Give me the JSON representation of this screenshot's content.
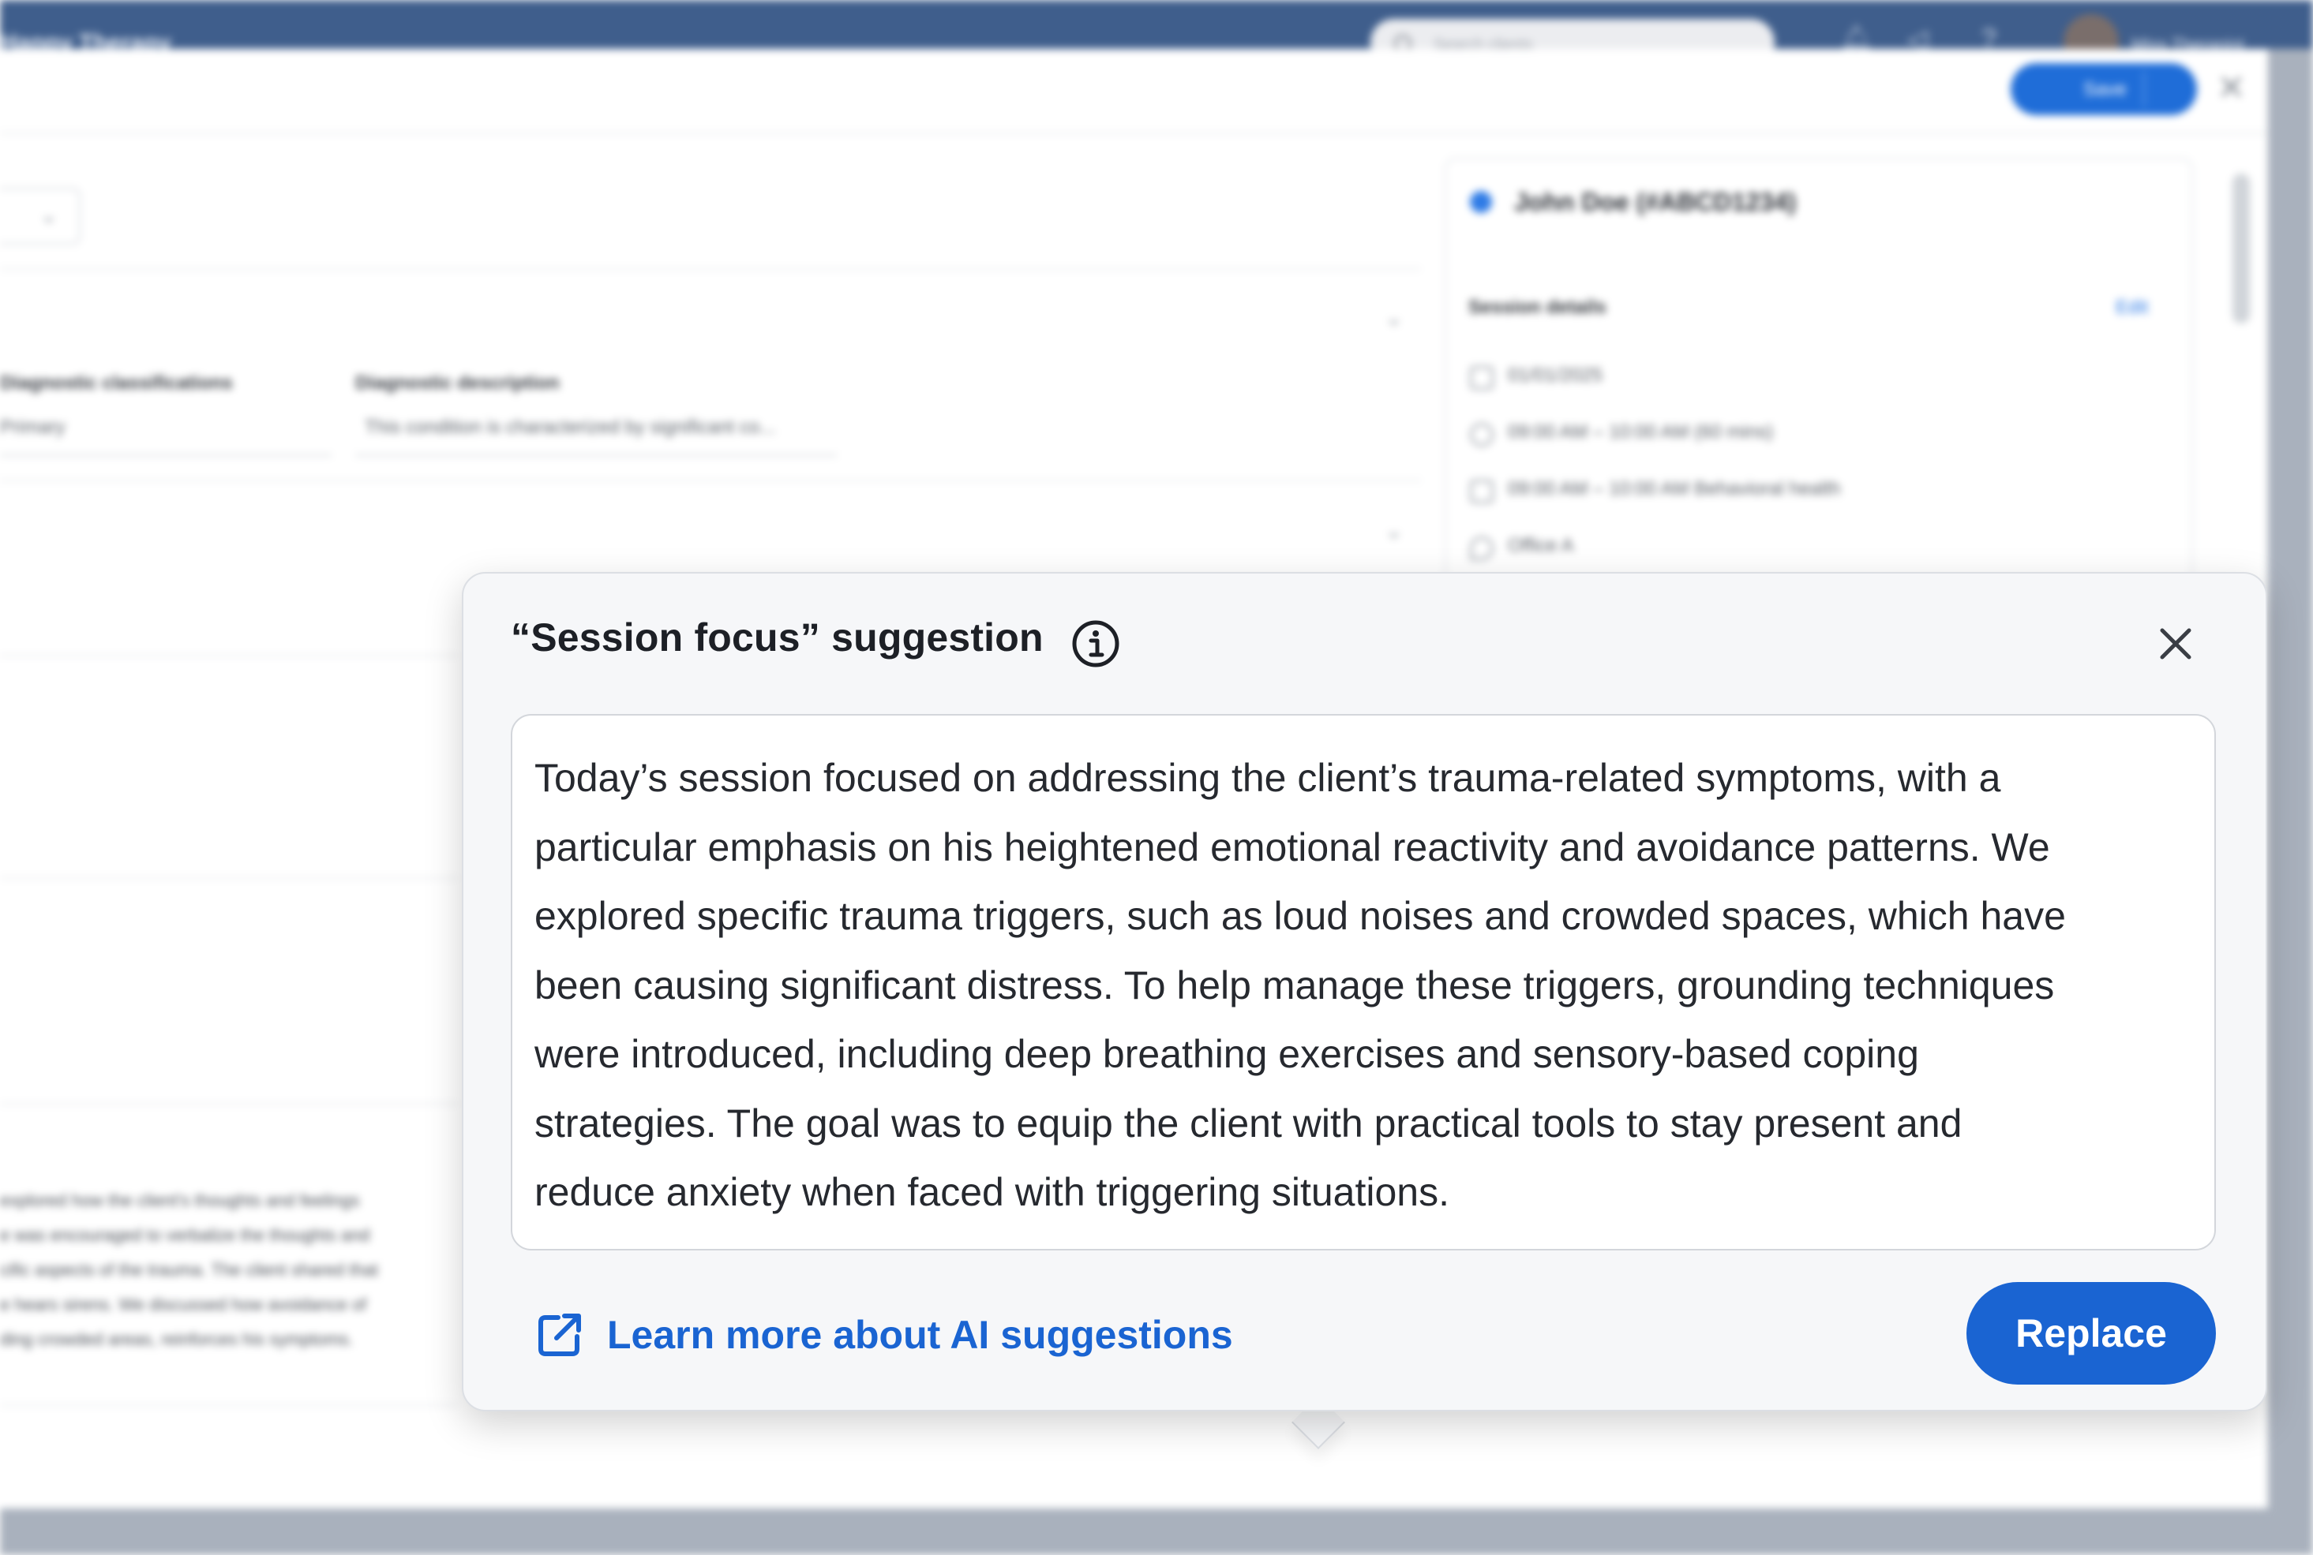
{
  "app": {
    "brand": "Happy Therapy",
    "search_placeholder": "Search clients",
    "user_name": "Miss Therapist",
    "save_label": "Save"
  },
  "note_form": {
    "diag_class_label": "Diagnostic classifications",
    "diag_class_value": "Primary",
    "diag_desc_label": "Diagnostic description",
    "diag_desc_value": "This condition is characterized by significant co...",
    "narrative_lines": [
      "explored how the client's thoughts and feelings",
      "e was encouraged to verbalize the thoughts and",
      "cific aspects of the trauma. The client shared that",
      "e hears sirens. We discussed how avoidance of",
      "ding crowded areas, reinforces his symptoms."
    ]
  },
  "side_panel": {
    "client_name": "John Doe (#ABCD1234)",
    "session_details_label": "Session details",
    "edit_label": "Edit",
    "rows": [
      "01/01/2025",
      "09:00 AM – 10:00 AM (60 mins)",
      "09:00 AM – 10:00 AM Behavioral health",
      "Office A"
    ]
  },
  "suggestion": {
    "title": "“Session focus” suggestion",
    "body": "Today’s session focused on addressing the client’s trauma-related symptoms, with a\nparticular emphasis on his heightened emotional reactivity and avoidance patterns. We\nexplored specific trauma triggers, such as loud noises and crowded spaces, which have\nbeen causing significant distress. To help manage these triggers, grounding techniques\nwere introduced, including deep breathing exercises and sensory-based coping\nstrategies. The goal was to equip the client with practical tools to stay present and\nreduce anxiety when faced with triggering situations.",
    "learn_more_label": "Learn more about AI suggestions",
    "replace_label": "Replace",
    "icons": {
      "info": "info-icon",
      "close": "close-icon",
      "external_link": "external-link-icon"
    },
    "colors": {
      "accent": "#1a64d2",
      "title_text": "#1d2026",
      "body_text": "#26292f",
      "surface": "#f6f7f9"
    }
  }
}
